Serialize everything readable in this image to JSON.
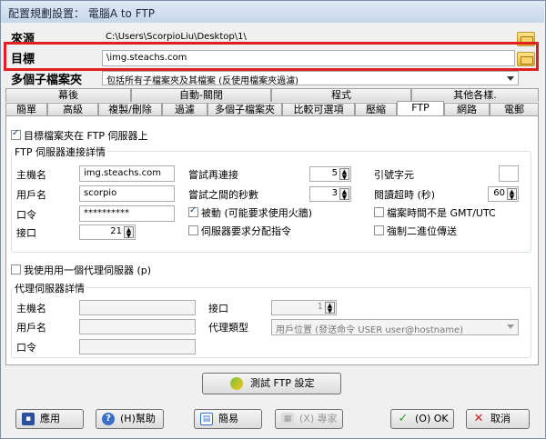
{
  "window": {
    "title": "配置規劃設置： 電腦A to FTP"
  },
  "source": {
    "label": "來源",
    "path": "C:\\Users\\ScorpioLiu\\Desktop\\1\\"
  },
  "target": {
    "label": "目標",
    "path": "\\img.steachs.com"
  },
  "multi_sub": {
    "label": "多個子檔案夾",
    "value": "包括所有子檔案夾及其檔案 (反使用檔案夾過濾)"
  },
  "tabs_row1": [
    "幕後",
    "自動-關閉",
    "程式",
    "其他各樣."
  ],
  "tabs_row2": [
    "簡單",
    "高級",
    "複製/刪除",
    "過濾",
    "多個子檔案夾",
    "比較可選項",
    "壓縮",
    "FTP",
    "網路",
    "電郵"
  ],
  "active_tab": "FTP",
  "ftp": {
    "target_on_ftp_label": "目標檔案夾在 FTP 伺服器上",
    "details_title": "FTP 伺服器連接詳情",
    "host_label": "主機名",
    "host_value": "img.steachs.com",
    "user_label": "用戶名",
    "user_value": "scorpio",
    "password_label": "口令",
    "password_value": "**********",
    "port_label": "接口",
    "port_value": "21",
    "retry_label": "嘗試再連接",
    "retry_value": "5",
    "retry_wait_label": "嘗試之間的秒數",
    "retry_wait_value": "3",
    "passive_label": "被動 (可能要求使用火牆)",
    "server_alloc_label": "伺服器要求分配指令",
    "quote_char_label": "引號字元",
    "quote_char_value": "",
    "read_timeout_label": "閱讀超時 (秒)",
    "read_timeout_value": "60",
    "not_gmt_label": "檔案時間不是 GMT/UTC",
    "force_binary_label": "強制二進位傳送"
  },
  "proxy": {
    "use_label": "我使用用一個代理伺服器 (p)",
    "details_title": "代理伺服器詳情",
    "host_label": "主機名",
    "user_label": "用戶名",
    "password_label": "口令",
    "port_label": "接口",
    "port_value": "1",
    "type_label": "代理類型",
    "type_value": "用戶位置 (發送命令 USER user@hostname)"
  },
  "test_button": "測試 FTP 設定",
  "footer": {
    "apply": "應用",
    "help": "(H)幫助",
    "simple": "簡易",
    "expert": "(X) 專家",
    "ok": "(O) OK",
    "cancel": "取消"
  },
  "colors": {
    "highlight": "#e02020",
    "accent": "#1a3e8c"
  }
}
